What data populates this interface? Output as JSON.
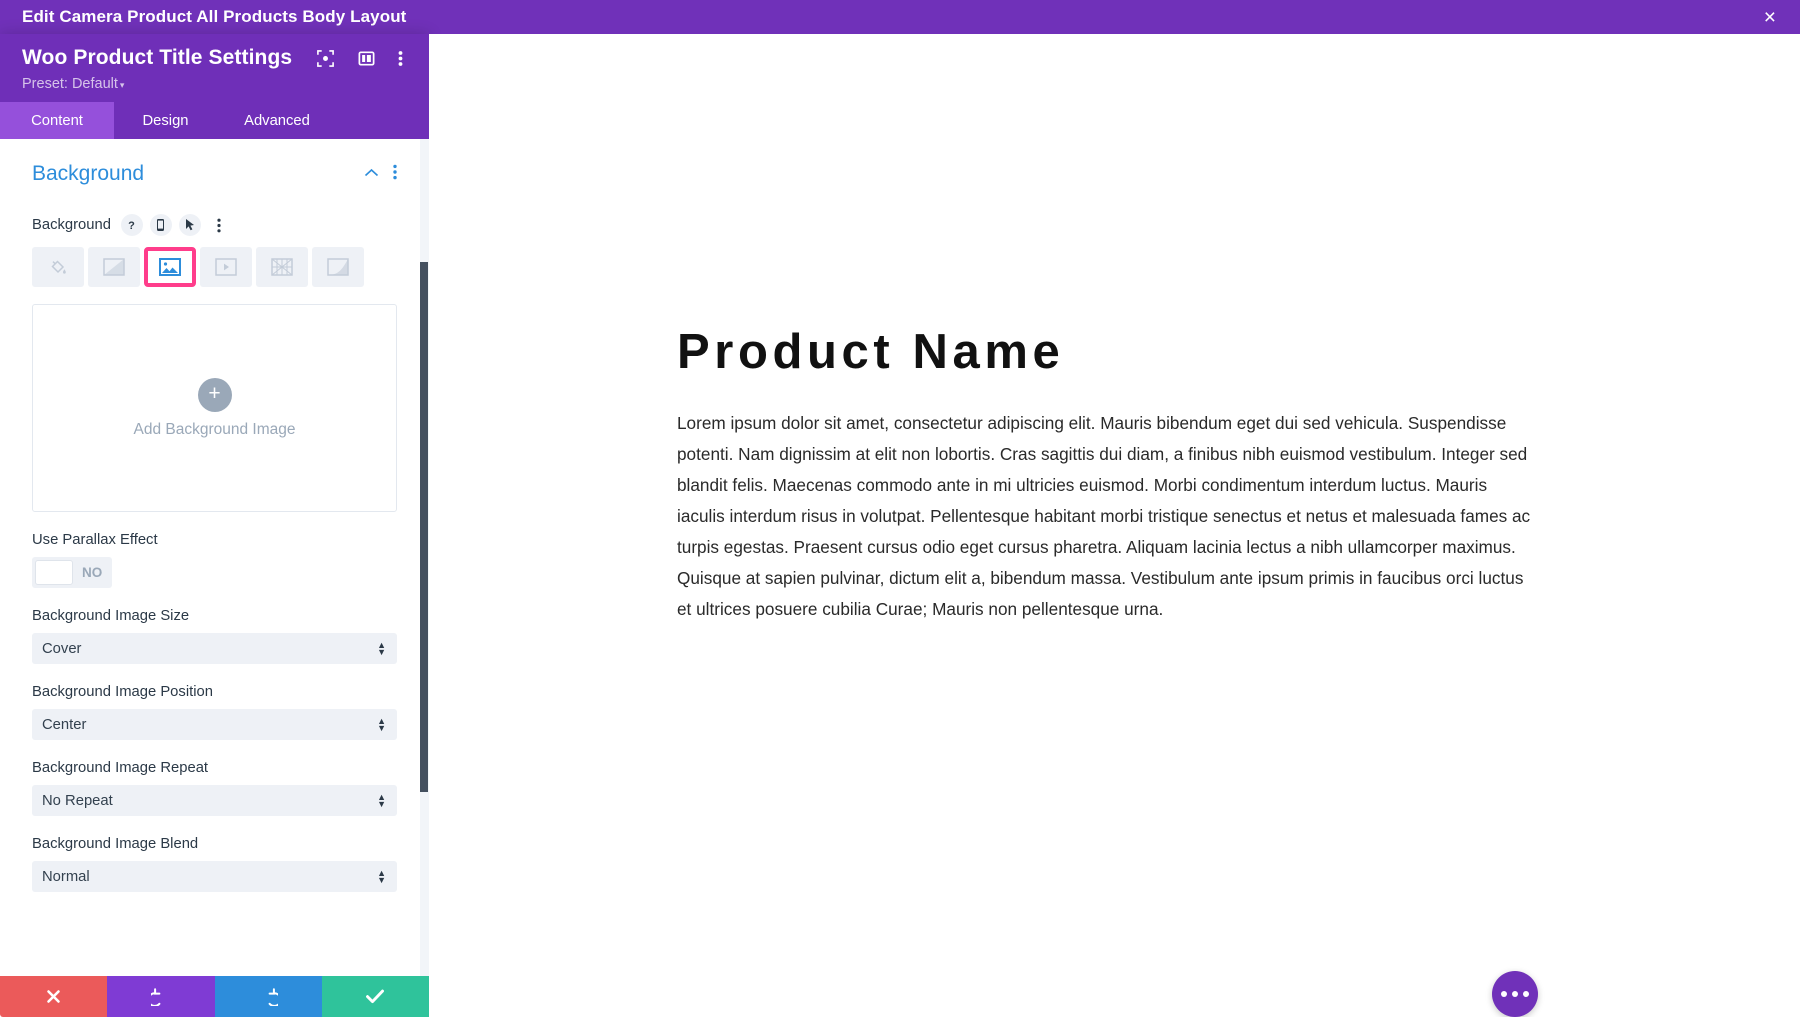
{
  "topbar": {
    "title": "Edit Camera Product All Products Body Layout",
    "close_label": "×"
  },
  "panel": {
    "title": "Woo Product Title Settings",
    "preset_label": "Preset: Default",
    "preset_caret": "▾",
    "header_icons": [
      "focus-frame-icon",
      "layout-columns-icon",
      "kebab-menu-icon"
    ],
    "tabs": [
      {
        "label": "Content",
        "active": true
      },
      {
        "label": "Design",
        "active": false
      },
      {
        "label": "Advanced",
        "active": false
      }
    ],
    "section": {
      "title": "Background",
      "collapse_icon": "chevron-up-icon",
      "options_icon": "kebab-menu-icon"
    },
    "background_field": {
      "label": "Background",
      "icons": [
        "help-icon",
        "mobile-device-icon",
        "cursor-hover-icon",
        "kebab-menu-icon"
      ],
      "types": [
        {
          "name": "background-color",
          "selected": false
        },
        {
          "name": "background-gradient",
          "selected": false
        },
        {
          "name": "background-image",
          "selected": true
        },
        {
          "name": "background-video",
          "selected": false
        },
        {
          "name": "background-pattern",
          "selected": false
        },
        {
          "name": "background-mask",
          "selected": false
        }
      ]
    },
    "upload": {
      "plus_label": "+",
      "text": "Add Background Image"
    },
    "parallax": {
      "label": "Use Parallax Effect",
      "value": "NO"
    },
    "fields": [
      {
        "label": "Background Image Size",
        "value": "Cover"
      },
      {
        "label": "Background Image Position",
        "value": "Center"
      },
      {
        "label": "Background Image Repeat",
        "value": "No Repeat"
      },
      {
        "label": "Background Image Blend",
        "value": "Normal"
      }
    ],
    "actions": [
      {
        "name": "cancel",
        "icon": "close-x-icon",
        "color": "#eb5a5a"
      },
      {
        "name": "undo",
        "icon": "undo-arrow-icon",
        "color": "#7f3bd4"
      },
      {
        "name": "redo",
        "icon": "redo-arrow-icon",
        "color": "#2d8ddb"
      },
      {
        "name": "save",
        "icon": "checkmark-icon",
        "color": "#2fc39b"
      }
    ]
  },
  "canvas": {
    "product_title": "Product Name",
    "product_body": "Lorem ipsum dolor sit amet, consectetur adipiscing elit. Mauris bibendum eget dui sed vehicula. Suspendisse potenti. Nam dignissim at elit non lobortis. Cras sagittis dui diam, a finibus nibh euismod vestibulum. Integer sed blandit felis. Maecenas commodo ante in mi ultricies euismod. Morbi condimentum interdum luctus. Mauris iaculis interdum risus in volutpat. Pellentesque habitant morbi tristique senectus et netus et malesuada fames ac turpis egestas. Praesent cursus odio eget cursus pharetra. Aliquam lacinia lectus a nibh ullamcorper maximus. Quisque at sapien pulvinar, dictum elit a, bibendum massa. Vestibulum ante ipsum primis in faucibus orci luctus et ultrices posuere cubilia Curae; Mauris non pellentesque urna.",
    "fab_icon": "ellipsis-menu-icon"
  },
  "colors": {
    "topbar_purple": "#7031b9",
    "panel_purple": "#6f2fb8",
    "active_tab_purple": "#9550db",
    "accent_blue": "#2d8ddb",
    "highlight_pink": "#ff3d8b",
    "cancel_red": "#eb5a5a",
    "undo_purple": "#7f3bd4",
    "redo_blue": "#2d8ddb",
    "save_green": "#2fc39b"
  }
}
